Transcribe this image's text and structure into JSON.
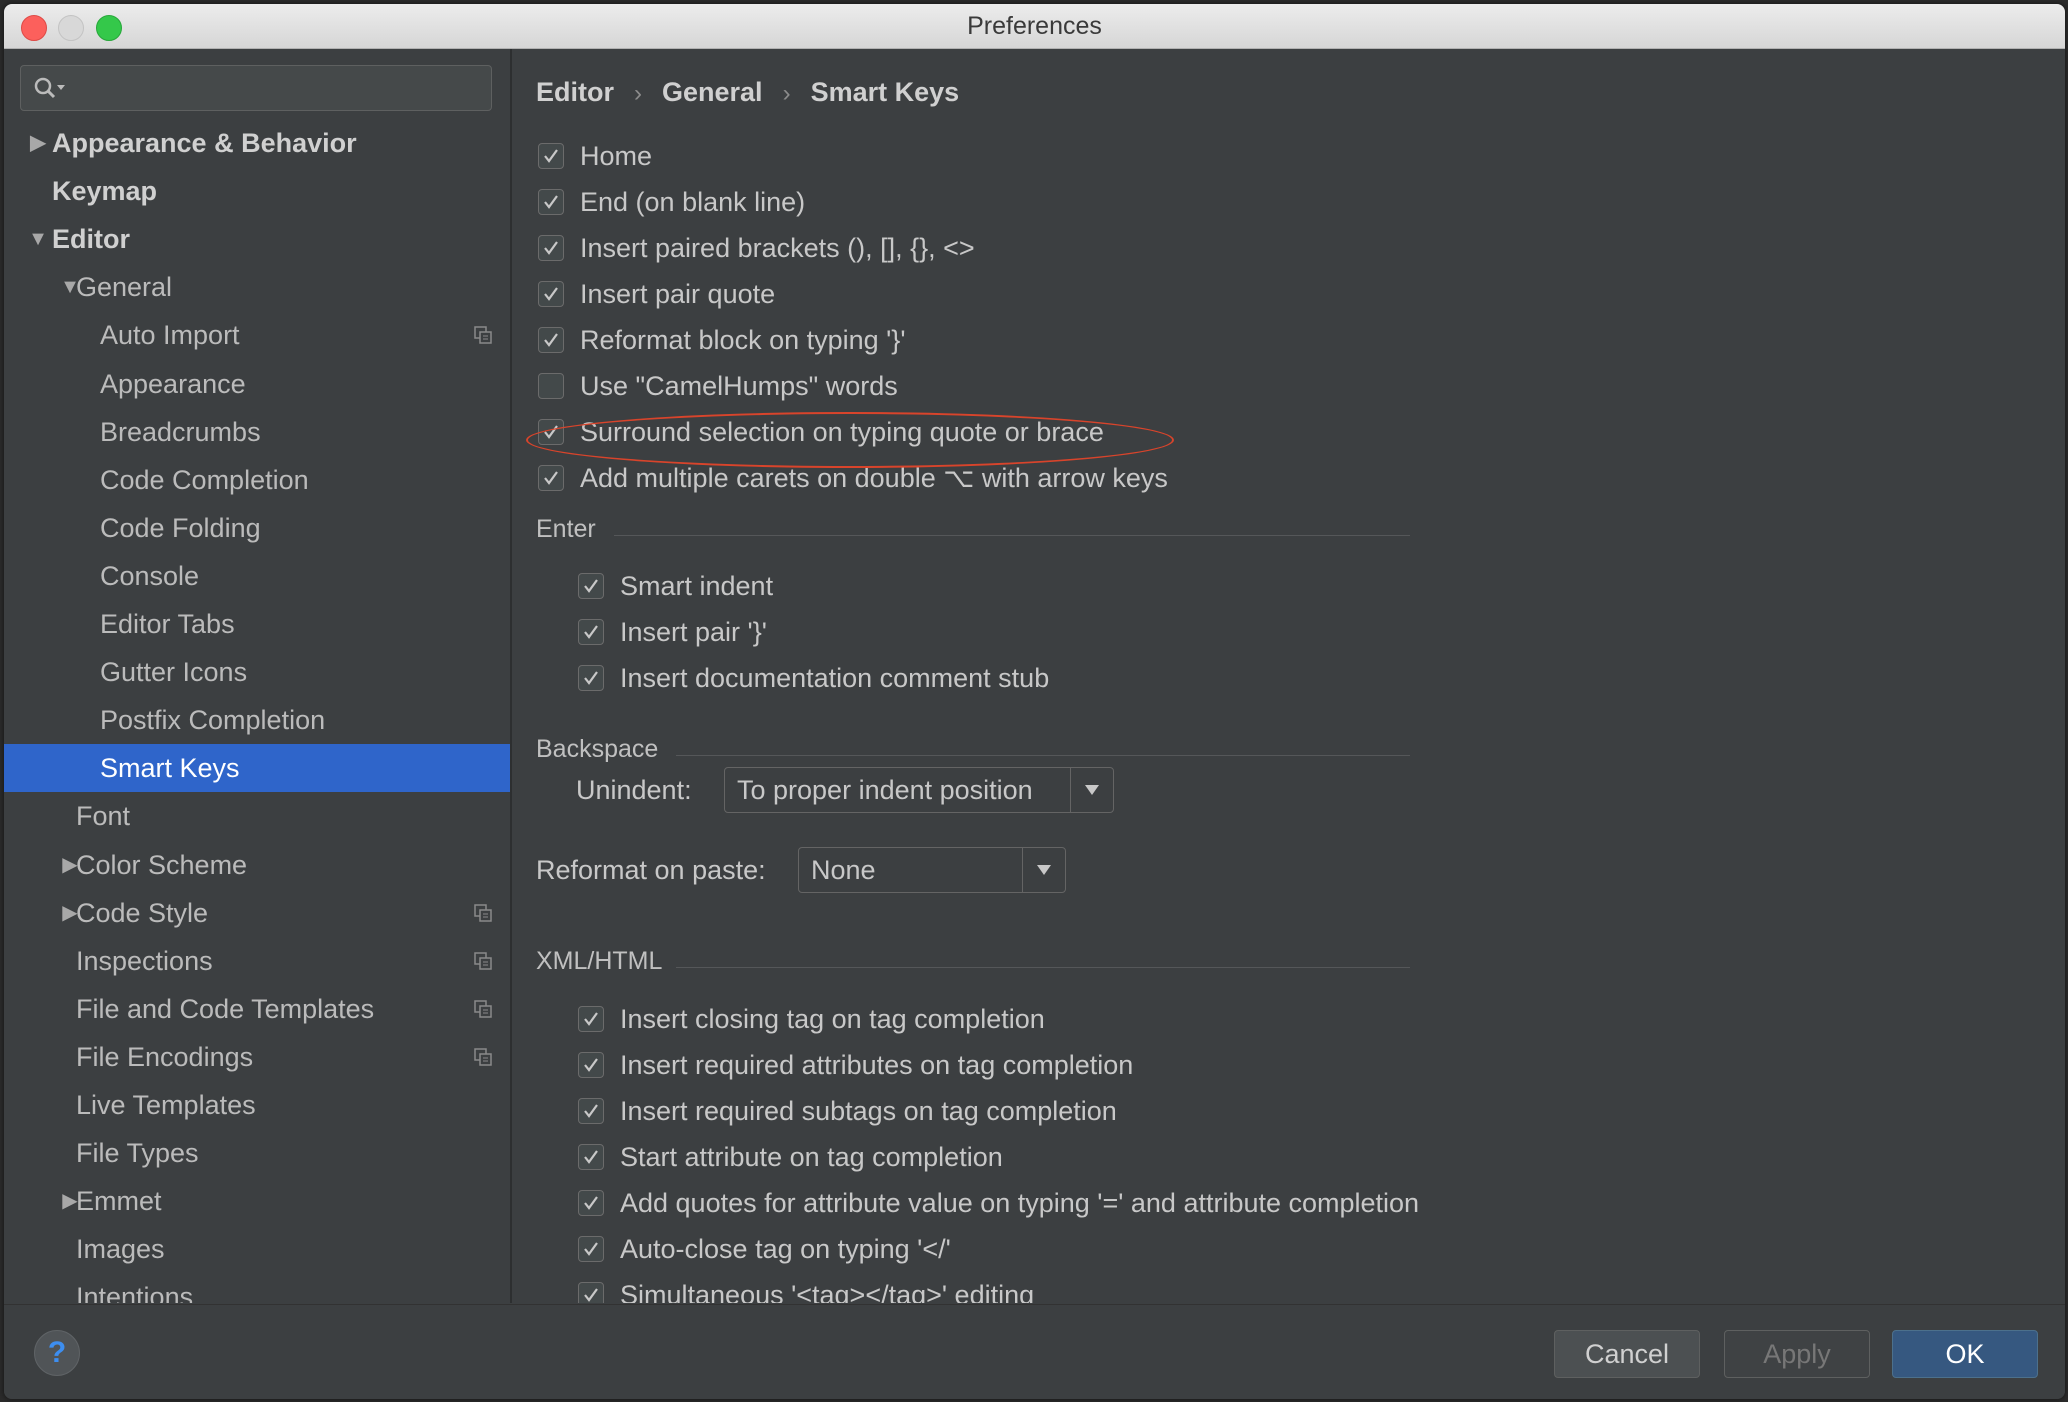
{
  "window": {
    "title": "Preferences"
  },
  "sidebar": {
    "search_placeholder": "",
    "items": [
      {
        "label": "Appearance & Behavior",
        "bold": true,
        "arrow": "right",
        "level": 0
      },
      {
        "label": "Keymap",
        "bold": true,
        "arrow": "",
        "level": 0
      },
      {
        "label": "Editor",
        "bold": true,
        "arrow": "down",
        "level": 0
      },
      {
        "label": "General",
        "arrow": "down",
        "level": 1
      },
      {
        "label": "Auto Import",
        "level": 2,
        "project_icon": true
      },
      {
        "label": "Appearance",
        "level": 2
      },
      {
        "label": "Breadcrumbs",
        "level": 2
      },
      {
        "label": "Code Completion",
        "level": 2
      },
      {
        "label": "Code Folding",
        "level": 2
      },
      {
        "label": "Console",
        "level": 2
      },
      {
        "label": "Editor Tabs",
        "level": 2
      },
      {
        "label": "Gutter Icons",
        "level": 2
      },
      {
        "label": "Postfix Completion",
        "level": 2
      },
      {
        "label": "Smart Keys",
        "level": 2,
        "selected": true
      },
      {
        "label": "Font",
        "level": 1
      },
      {
        "label": "Color Scheme",
        "arrow": "right",
        "level": 1
      },
      {
        "label": "Code Style",
        "arrow": "right",
        "level": 1,
        "project_icon": true
      },
      {
        "label": "Inspections",
        "level": 1,
        "project_icon": true
      },
      {
        "label": "File and Code Templates",
        "level": 1,
        "project_icon": true
      },
      {
        "label": "File Encodings",
        "level": 1,
        "project_icon": true
      },
      {
        "label": "Live Templates",
        "level": 1
      },
      {
        "label": "File Types",
        "level": 1
      },
      {
        "label": "Emmet",
        "arrow": "right",
        "level": 1
      },
      {
        "label": "Images",
        "level": 1
      },
      {
        "label": "Intentions",
        "level": 1
      }
    ]
  },
  "breadcrumb": [
    "Editor",
    "General",
    "Smart Keys"
  ],
  "main_options": [
    {
      "label": "Home",
      "checked": true
    },
    {
      "label": "End (on blank line)",
      "checked": true
    },
    {
      "label": "Insert paired brackets (), [], {}, <>",
      "checked": true
    },
    {
      "label": "Insert pair quote",
      "checked": true
    },
    {
      "label": "Reformat block on typing '}'",
      "checked": true
    },
    {
      "label": "Use \"CamelHumps\" words",
      "checked": false
    },
    {
      "label": "Surround selection on typing quote or brace",
      "checked": true,
      "highlighted": true
    },
    {
      "label": "Add multiple carets on double ⌥ with arrow keys",
      "checked": true
    }
  ],
  "enter": {
    "title": "Enter",
    "options": [
      {
        "label": "Smart indent",
        "checked": true
      },
      {
        "label": "Insert pair '}'",
        "checked": true
      },
      {
        "label": "Insert documentation comment stub",
        "checked": true
      }
    ]
  },
  "backspace": {
    "title": "Backspace",
    "unindent_label": "Unindent:",
    "unindent_value": "To proper indent position"
  },
  "reformat": {
    "label": "Reformat on paste:",
    "value": "None"
  },
  "xml_html": {
    "title": "XML/HTML",
    "options": [
      {
        "label": "Insert closing tag on tag completion",
        "checked": true
      },
      {
        "label": "Insert required attributes on tag completion",
        "checked": true
      },
      {
        "label": "Insert required subtags on tag completion",
        "checked": true
      },
      {
        "label": "Start attribute on tag completion",
        "checked": true
      },
      {
        "label": "Add quotes for attribute value on typing '=' and attribute completion",
        "checked": true
      },
      {
        "label": "Auto-close tag on typing '</'",
        "checked": true
      },
      {
        "label": "Simultaneous '<tag></tag>' editing",
        "checked": true
      }
    ]
  },
  "footer": {
    "help": "?",
    "cancel": "Cancel",
    "apply": "Apply",
    "ok": "OK"
  },
  "colors": {
    "selection": "#2f65ca",
    "highlight_ellipse": "#d9442b",
    "ok_button": "#365880"
  }
}
